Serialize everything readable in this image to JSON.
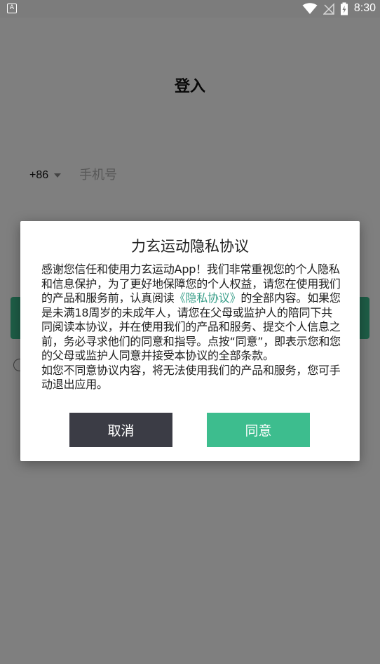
{
  "status_bar": {
    "left_icon": "notification-a-icon",
    "left_icon_glyph": "A",
    "wifi_icon": "wifi-icon",
    "signal_icon": "no-signal-icon",
    "battery_icon": "battery-charging-icon",
    "time": "8:30"
  },
  "page": {
    "title": "登入",
    "country_code": "+86",
    "phone_placeholder": "手机号"
  },
  "dialog": {
    "title": "力玄运动隐私协议",
    "body_part1": "感谢您信任和使用力玄运动App！我们非常重视您的个人隐私和信息保护，为了更好地保障您的个人权益，请您在使用我们的产品和服务前，认真阅读",
    "policy_link": "《隐私协议》",
    "body_part2": "的全部内容。如果您是未满18周岁的未成年人，请您在父母或监护人的陪同下共同阅读本协议，并在使用我们的产品和服务、提交个人信息之前，务必寻求他们的同意和指导。点按“同意”，即表示您和您的父母或监护人同意并接受本协议的全部条款。",
    "body_part3": "如您不同意协议内容，将无法使用我们的产品和服务，您可手动退出应用。",
    "cancel_label": "取消",
    "agree_label": "同意"
  },
  "colors": {
    "accent_green": "#3dbd8e",
    "cancel_dark": "#3b3c45",
    "link_teal": "#3a9f8a"
  }
}
